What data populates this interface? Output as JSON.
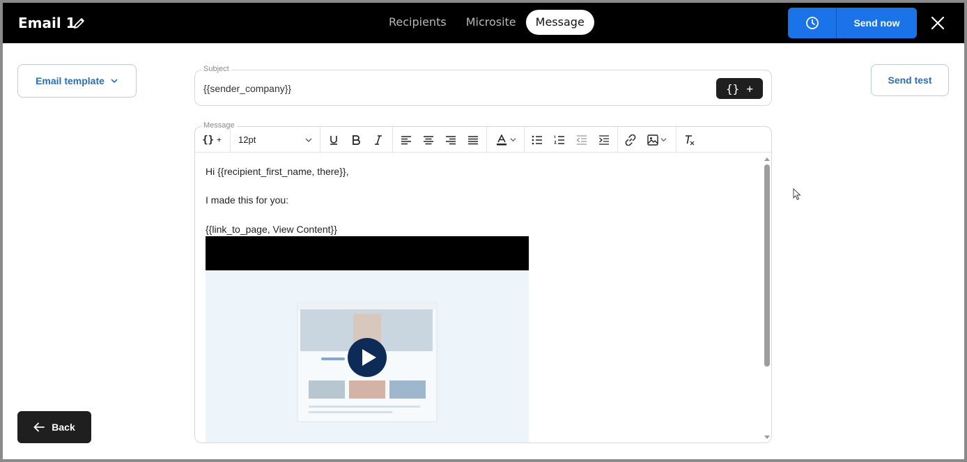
{
  "header": {
    "title": "Email 1",
    "tabs": [
      {
        "label": "Recipients",
        "active": false
      },
      {
        "label": "Microsite",
        "active": false
      },
      {
        "label": "Message",
        "active": true
      }
    ],
    "send_now_label": "Send now"
  },
  "left": {
    "template_label": "Email template"
  },
  "right": {
    "send_test_label": "Send test"
  },
  "subject": {
    "label": "Subject",
    "value": "{{sender_company}}",
    "var_button": "{} +"
  },
  "message": {
    "label": "Message",
    "font_size": "12pt",
    "lines": [
      "Hi {{recipient_first_name, there}},",
      "I made this for you:",
      "{{link_to_page, View Content}}"
    ]
  },
  "footer": {
    "back_label": "Back"
  },
  "colors": {
    "accent": "#1a73e8",
    "dark": "#1f1f1f",
    "link": "#2a6fb6"
  }
}
